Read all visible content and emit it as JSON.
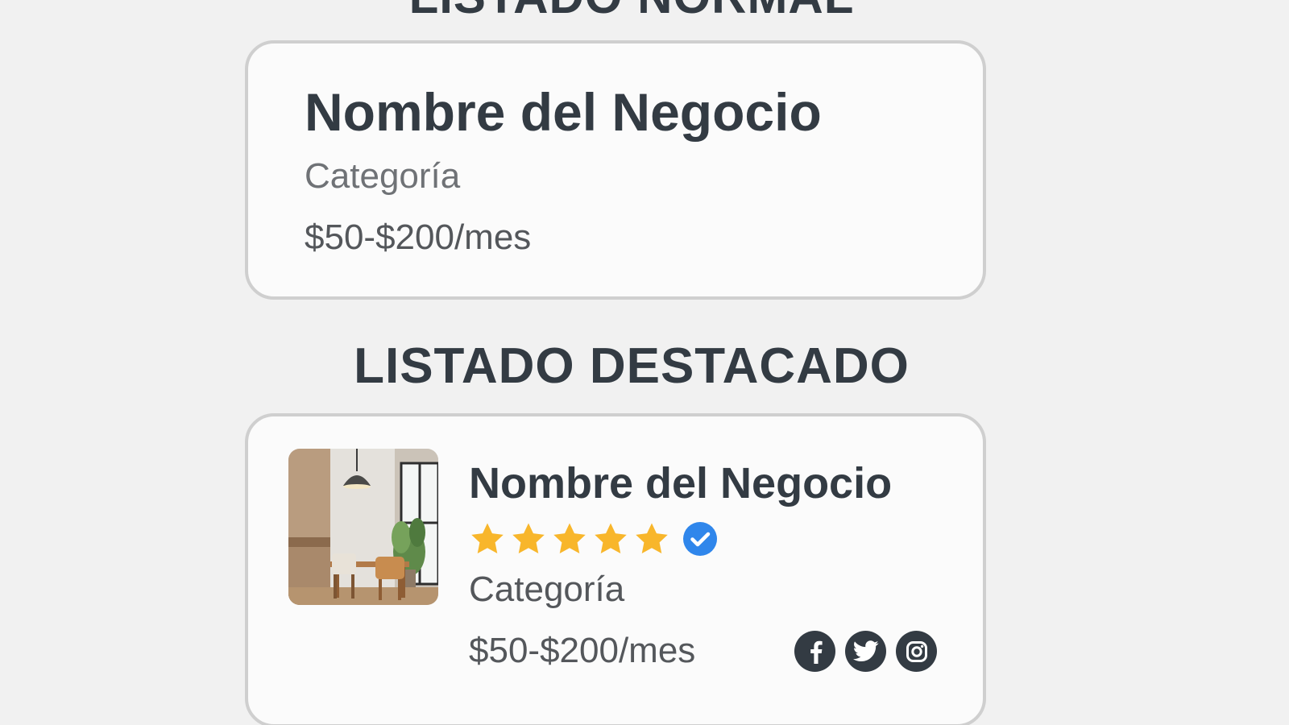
{
  "normal_section": {
    "heading": "LISTADO NORMAL",
    "card": {
      "business_name": "Nombre del Negocio",
      "category": "Categoría",
      "price": "$50-$200/mes"
    }
  },
  "featured_section": {
    "heading": "LISTADO DESTACADO",
    "card": {
      "image_icon": "dining-room-photo",
      "business_name": "Nombre del Negocio",
      "rating": 5,
      "rating_max": 5,
      "verified_icon": "verified-check-icon",
      "category": "Categoría",
      "price": "$50-$200/mes",
      "social_icons": [
        "facebook-icon",
        "twitter-icon",
        "instagram-icon"
      ]
    }
  },
  "colors": {
    "background": "#f1f1f1",
    "card_background": "#fbfbfb",
    "card_border": "#cfcfcf",
    "heading_text": "#333b43",
    "star": "#f8b62b",
    "verified": "#2f86eb",
    "social_circle": "#333b43"
  }
}
